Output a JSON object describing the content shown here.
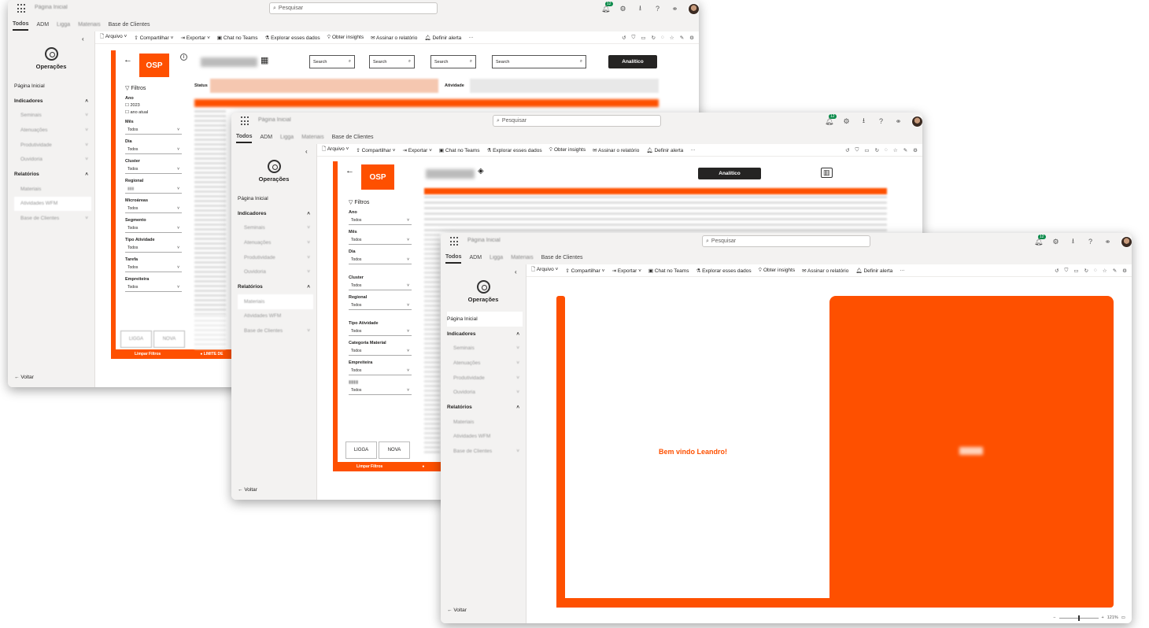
{
  "app": {
    "breadcrumb": "Página Inicial",
    "search_placeholder": "Pesquisar",
    "notif_count": "12",
    "tabs": [
      "Todos",
      "ADM",
      "Ligga",
      "Materiais",
      "Base de Clientes"
    ]
  },
  "report_toolbar": {
    "arquivo": "Arquivo",
    "compartilhar": "Compartilhar",
    "exportar": "Exportar",
    "chat": "Chat no Teams",
    "explorar": "Explorar esses dados",
    "insights": "Obter insights",
    "assinar": "Assinar o relatório",
    "alerta": "Definir alerta",
    "more": "···"
  },
  "sidebar": {
    "app_title": "Operações",
    "home": "Página Inicial",
    "indicadores": "Indicadores",
    "indicadores_items": [
      "Seminais",
      "Atenuações",
      "Produtividade",
      "Ouvidoria"
    ],
    "relatorios": "Relatórios",
    "relatorios_items": [
      "Materiais",
      "Atividades WFM",
      "Base de Clientes"
    ],
    "voltar": "Voltar"
  },
  "report": {
    "brand": "OSP",
    "filtros": "Filtros",
    "analitico": "Analítico",
    "search": "Search",
    "status_label": "Status",
    "atividade_label": "Atividade",
    "limpar_filtros": "Limpar Filtros",
    "limite": "LIMITE DE",
    "ligga_btn": "LIGGA",
    "nova_btn": "NOVA",
    "todos": "Todos",
    "welcome": "Bem vindo Leandro!",
    "zoom": "121%"
  },
  "filters_w1": {
    "ano": "Ano",
    "ano_opts": [
      "2023",
      "ano atual"
    ],
    "mes": "Mês",
    "dia": "Dia",
    "cluster": "Cluster",
    "regional": "Regional",
    "microareas": "Microáreas",
    "segmento": "Segmento",
    "tipo_atividade": "Tipo Atividade",
    "tarefa": "Tarefa",
    "empreiteira": "Empreiteira"
  },
  "filters_w2": {
    "ano": "Ano",
    "mes": "Mês",
    "dia": "Dia",
    "cluster": "Cluster",
    "regional": "Regional",
    "tipo_atividade": "Tipo Atividade",
    "categoria_material": "Categoria Material",
    "empreiteira": "Empreiteira"
  },
  "colors": {
    "accent": "#fe5000",
    "dark": "#252423"
  }
}
